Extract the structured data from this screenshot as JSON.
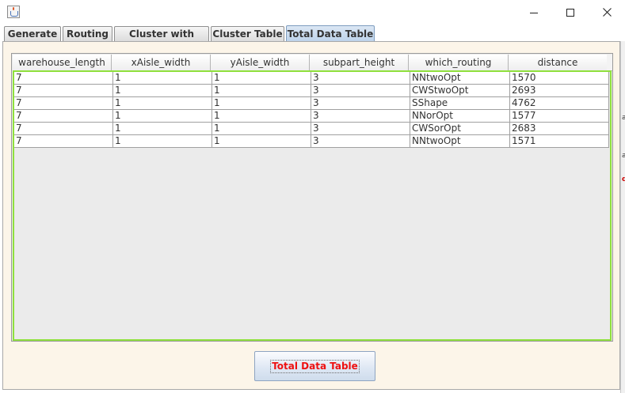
{
  "window": {
    "controls": {
      "minimize_icon": "minimize-icon",
      "maximize_icon": "maximize-icon",
      "close_icon": "close-icon"
    }
  },
  "tabs": [
    {
      "label": "Generate",
      "active": false
    },
    {
      "label": "Routing",
      "active": false
    },
    {
      "label": "Cluster with Tabu",
      "active": false
    },
    {
      "label": "Cluster Table",
      "active": false
    },
    {
      "label": "Total Data Table",
      "active": true
    }
  ],
  "table": {
    "columns": [
      "warehouse_length",
      "xAisle_width",
      "yAisle_width",
      "subpart_height",
      "which_routing",
      "distance"
    ],
    "rows": [
      [
        "7",
        "1",
        "1",
        "3",
        "NNtwoOpt",
        "1570"
      ],
      [
        "7",
        "1",
        "1",
        "3",
        "CWStwoOpt",
        "2693"
      ],
      [
        "7",
        "1",
        "1",
        "3",
        "SShape",
        "4762"
      ],
      [
        "7",
        "1",
        "1",
        "3",
        "NNorOpt",
        "1577"
      ],
      [
        "7",
        "1",
        "1",
        "3",
        "CWSorOpt",
        "2683"
      ],
      [
        "7",
        "1",
        "1",
        "3",
        "NNtwoOpt",
        "1571"
      ]
    ]
  },
  "action_button": {
    "label": "Total Data Table",
    "color": "#ee1111"
  },
  "edge_glyphs": [
    "a",
    "a",
    "d"
  ],
  "colors": {
    "panel_background": "#fcf5e9",
    "viewport_border": "#8fe03c",
    "active_tab": "#bcd2ea"
  }
}
